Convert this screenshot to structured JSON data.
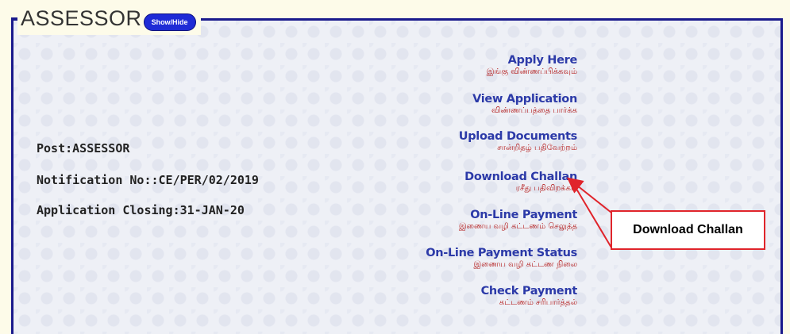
{
  "section": {
    "title": "ASSESSOR",
    "toggle_label": "Show/Hide"
  },
  "details": {
    "post": "Post:ASSESSOR",
    "notification": "Notification No::CE/PER/02/2019",
    "closing": "Application Closing:31-JAN-20"
  },
  "links": [
    {
      "en": "Apply Here",
      "ta": "இங்கு விண்ணப்பிக்கவும்"
    },
    {
      "en": "View Application",
      "ta": "விண்ணப்பத்தை பார்க்க"
    },
    {
      "en": "Upload Documents",
      "ta": "சான்றிதழ் பதிவேற்றம்"
    },
    {
      "en": "Download Challan",
      "ta": "ரசீது பதிவிறக்கம்"
    },
    {
      "en": "On-Line Payment",
      "ta": "இணைய வழி கட்டணம் செலுத்த"
    },
    {
      "en": "On-Line Payment Status",
      "ta": "இணைய வழி கட்டண நிலை"
    },
    {
      "en": "Check Payment",
      "ta": "கட்டணம் சரிபார்த்தல்"
    }
  ],
  "callout": {
    "text": "Download Challan",
    "color": "#e0242b"
  }
}
